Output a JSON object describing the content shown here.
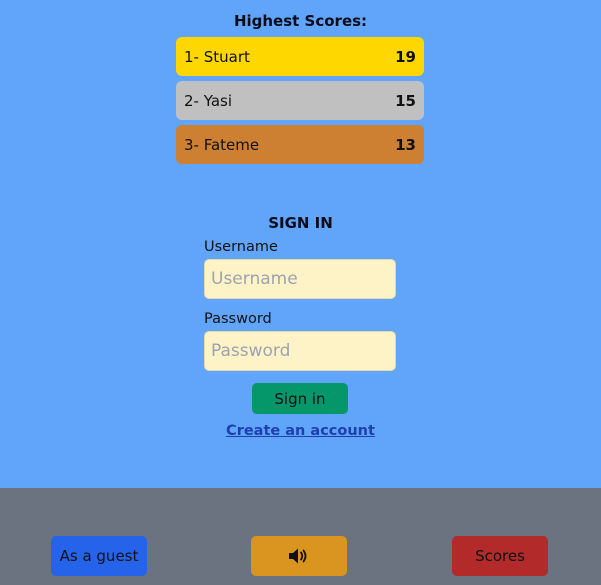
{
  "colors": {
    "page_bg": "#60a5fa",
    "footer_bg": "#6b7280",
    "gold": "#ffd700",
    "silver": "#c0c0c0",
    "bronze": "#cd7f32",
    "input_bg": "#fef3c7",
    "signin_btn": "#059669",
    "guest_btn": "#2563eb",
    "sound_btn": "#d9951f",
    "scores_btn": "#b22a2a",
    "link": "#1e40af"
  },
  "highscores": {
    "title": "Highest Scores:",
    "entries": [
      {
        "label": "1- Stuart",
        "score": "19",
        "color": "#ffd700"
      },
      {
        "label": "2- Yasi",
        "score": "15",
        "color": "#c0c0c0"
      },
      {
        "label": "3- Fateme",
        "score": "13",
        "color": "#cd7f32"
      }
    ]
  },
  "signin": {
    "title": "SIGN IN",
    "username_label": "Username",
    "username_placeholder": "Username",
    "username_value": "",
    "password_label": "Password",
    "password_placeholder": "Password",
    "password_value": "",
    "submit_label": "Sign in",
    "create_account_label": "Create an account"
  },
  "footer": {
    "guest_label": "As a guest",
    "sound_icon": "speaker-volume-icon",
    "scores_label": "Scores"
  }
}
